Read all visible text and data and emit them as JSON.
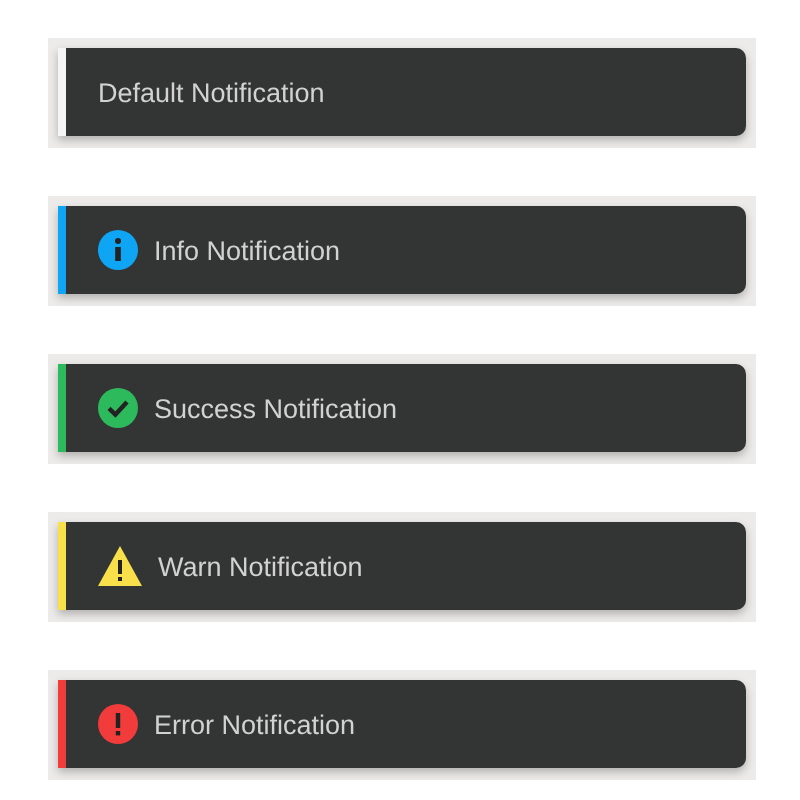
{
  "notifications": [
    {
      "kind": "default",
      "text": "Default Notification",
      "color": "#f5f5f5"
    },
    {
      "kind": "info",
      "text": "Info Notification",
      "color": "#0ea5f5"
    },
    {
      "kind": "success",
      "text": "Success Notification",
      "color": "#2dba5c"
    },
    {
      "kind": "warn",
      "text": "Warn Notification",
      "color": "#f9e04a"
    },
    {
      "kind": "error",
      "text": "Error Notification",
      "color": "#f23b3b"
    }
  ]
}
